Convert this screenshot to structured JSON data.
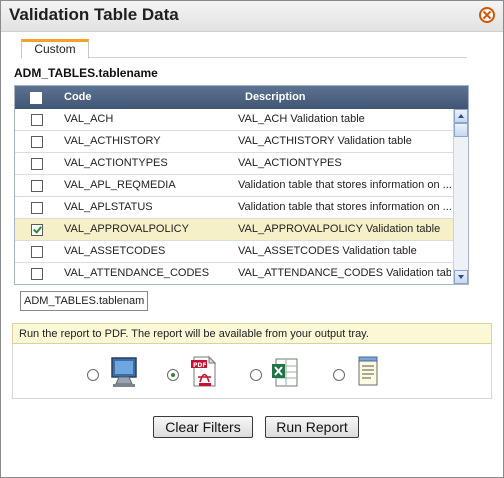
{
  "dialog": {
    "title": "Validation Table Data",
    "tab_label": "Custom",
    "field_label": "ADM_TABLES.tablename"
  },
  "grid": {
    "columns": {
      "code": "Code",
      "description": "Description"
    },
    "rows": [
      {
        "code": "VAL_ACH",
        "description": "VAL_ACH Validation table",
        "checked": false
      },
      {
        "code": "VAL_ACTHISTORY",
        "description": "VAL_ACTHISTORY Validation table",
        "checked": false
      },
      {
        "code": "VAL_ACTIONTYPES",
        "description": "VAL_ACTIONTYPES",
        "checked": false
      },
      {
        "code": "VAL_APL_REQMEDIA",
        "description": "Validation table that stores information on ...",
        "checked": false
      },
      {
        "code": "VAL_APLSTATUS",
        "description": "Validation table that stores information on ...",
        "checked": false
      },
      {
        "code": "VAL_APPROVALPOLICY",
        "description": "VAL_APPROVALPOLICY Validation table",
        "checked": true
      },
      {
        "code": "VAL_ASSETCODES",
        "description": "VAL_ASSETCODES Validation table",
        "checked": false
      },
      {
        "code": "VAL_ATTENDANCE_CODES",
        "description": "VAL_ATTENDANCE_CODES Validation table",
        "checked": false
      }
    ]
  },
  "filter": {
    "value": "ADM_TABLES.tablename"
  },
  "output": {
    "message": "Run the report to PDF. The report will be available from your output tray.",
    "formats": [
      {
        "icon": "monitor-icon",
        "selected": false
      },
      {
        "icon": "pdf-icon",
        "selected": true
      },
      {
        "icon": "excel-icon",
        "selected": false
      },
      {
        "icon": "notepad-icon",
        "selected": false
      }
    ]
  },
  "buttons": {
    "clear_filters": "Clear Filters",
    "run_report": "Run Report"
  }
}
